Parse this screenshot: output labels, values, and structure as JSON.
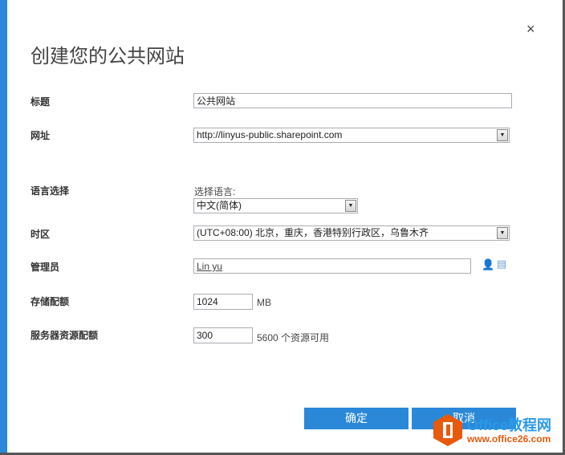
{
  "dialog": {
    "title": "创建您的公共网站",
    "close_icon": "×"
  },
  "fields": {
    "title_label": "标题",
    "title_value": "公共网站",
    "url_label": "网址",
    "url_value": "http://linyus-public.sharepoint.com",
    "language_label": "语言选择",
    "language_prompt": "选择语言:",
    "language_value": "中文(简体)",
    "timezone_label": "时区",
    "timezone_value": "(UTC+08:00) 北京，重庆，香港特别行政区，乌鲁木齐",
    "admin_label": "管理员",
    "admin_value": "Lin yu",
    "storage_label": "存储配额",
    "storage_value": "1024",
    "storage_unit": "MB",
    "resource_label": "服务器资源配额",
    "resource_value": "300",
    "resource_available": "5600 个资源可用"
  },
  "buttons": {
    "ok": "确定",
    "cancel": "取消"
  },
  "watermark": {
    "brand": "Office教程网",
    "url": "www.office26.com"
  }
}
